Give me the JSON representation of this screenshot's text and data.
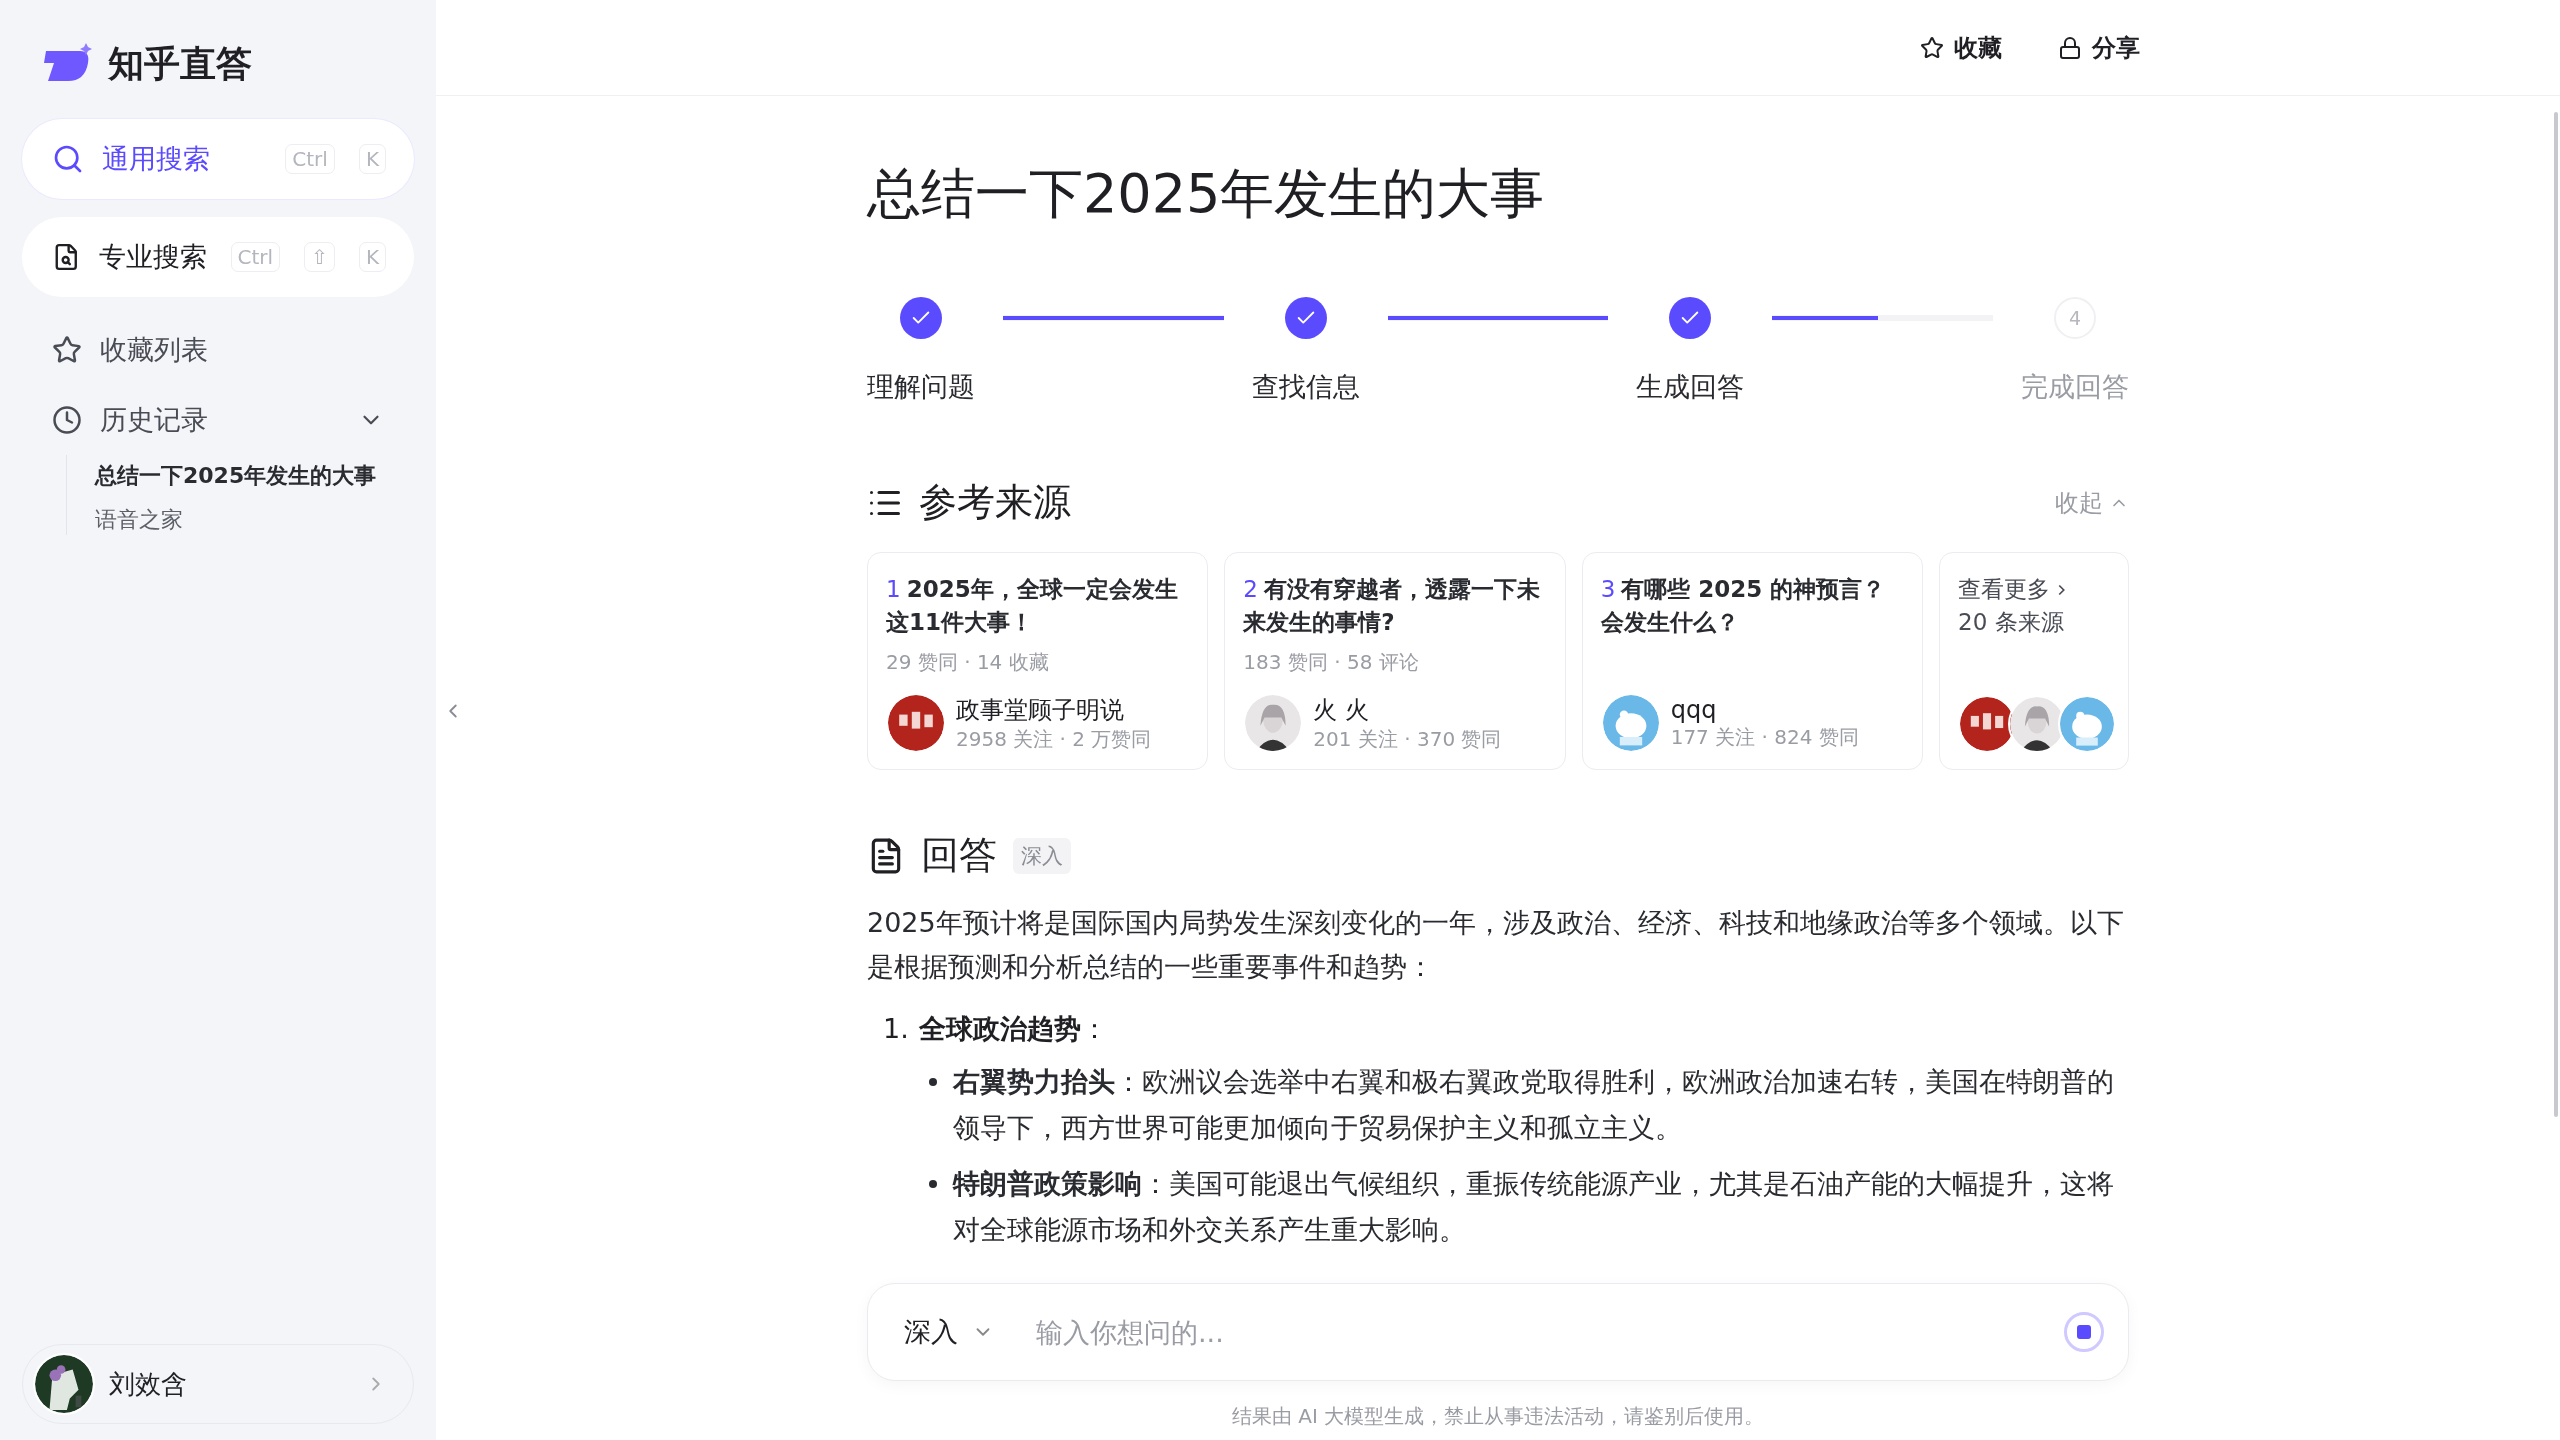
{
  "sidebar": {
    "logo_text": "知乎直答",
    "search_modes": [
      {
        "kind": "general",
        "label": "通用搜索",
        "keys": [
          "Ctrl",
          "K"
        ],
        "selected": true
      },
      {
        "kind": "pro",
        "label": "专业搜索",
        "keys": [
          "Ctrl",
          "⇧",
          "K"
        ],
        "selected": false
      }
    ],
    "items": [
      {
        "kind": "favorites",
        "label": "收藏列表"
      },
      {
        "kind": "history",
        "label": "历史记录",
        "expanded": true,
        "children": [
          {
            "label": "总结一下2025年发生的大事",
            "selected": true
          },
          {
            "label": "语音之家",
            "selected": false
          }
        ]
      }
    ],
    "user": {
      "name": "刘效含"
    }
  },
  "header": {
    "actions": [
      {
        "kind": "favorite",
        "label": "收藏"
      },
      {
        "kind": "share",
        "label": "分享"
      }
    ]
  },
  "title": "总结一下2025年发生的大事",
  "steps": [
    {
      "label": "理解问题",
      "done": true
    },
    {
      "label": "查找信息",
      "done": true
    },
    {
      "label": "生成回答",
      "done": true
    },
    {
      "label": "完成回答",
      "done": false,
      "number": "4"
    }
  ],
  "connectors": [
    {
      "level": 1
    },
    {
      "level": 1
    },
    {
      "level": 0.48
    }
  ],
  "sources": {
    "title": "参考来源",
    "collapse": "收起",
    "cards": [
      {
        "index": "1",
        "title": "2025年，全球一定会发生这11件大事！",
        "stats": "29 赞同 · 14 收藏",
        "author": "政事堂顾子明说",
        "author_stats": "2958 关注 · 2 万赞同"
      },
      {
        "index": "2",
        "title": "有没有穿越者，透露一下未来发生的事情?",
        "stats": "183 赞同 · 58 评论",
        "author": "火 火",
        "author_stats": "201 关注 · 370 赞同"
      },
      {
        "index": "3",
        "title": "有哪些 2025 的神预言？会发生什么？",
        "author": "qqq",
        "author_stats": "177 关注 · 824 赞同"
      }
    ],
    "more": {
      "label": "查看更多",
      "count": "20 条来源"
    }
  },
  "answer": {
    "title": "回答",
    "tag": "深入",
    "intro": "2025年预计将是国际国内局势发生深刻变化的一年，涉及政治、经济、科技和地缘政治等多个领域。以下是根据预测和分析总结的一些重要事件和趋势：",
    "sections": [
      {
        "number": "1.",
        "heading": "**全球政治趋势**：",
        "bullets": [
          "**右翼势力抬头**：欧洲议会选举中右翼和极右翼政党取得胜利，欧洲政治加速右转，美国在特朗普的领导下，西方世界可能更加倾向于贸易保护主义和孤立主义。",
          "**特朗普政策影响**：美国可能退出气候组织，重振传统能源产业，尤其是石油产能的大幅提升，这将对全球能源市场和外交关系产生重大影响。"
        ]
      }
    ]
  },
  "composer": {
    "mode": "深入",
    "placeholder": "输入你想问的..."
  },
  "footer": "结果由 AI 大模型生成，禁止从事违法活动，请鉴别后使用。"
}
